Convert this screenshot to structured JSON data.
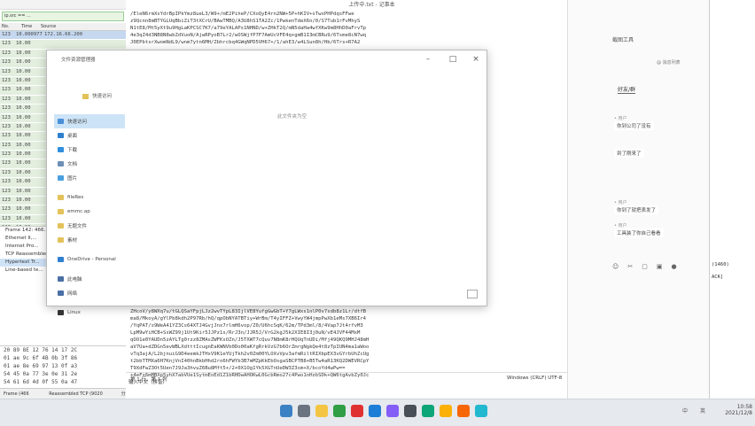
{
  "capture": {
    "filter": "ip.src == ...",
    "headers": [
      "No.",
      "Time",
      "Source"
    ],
    "rows": [
      {
        "no": "123",
        "time": "10.000977",
        "src": "172.16.66.200",
        "sel": true
      },
      {
        "no": "123",
        "time": "10.00",
        "src": "",
        "sel": false
      },
      {
        "no": "123",
        "time": "10.00",
        "src": "",
        "sel": false
      },
      {
        "no": "123",
        "time": "10.00",
        "src": "",
        "sel": false
      },
      {
        "no": "123",
        "time": "10.00",
        "src": "",
        "sel": false
      },
      {
        "no": "123",
        "time": "10.00",
        "src": "",
        "sel": false
      },
      {
        "no": "123",
        "time": "10.00",
        "src": "",
        "sel": false
      },
      {
        "no": "123",
        "time": "10.00",
        "src": "",
        "sel": false
      },
      {
        "no": "123",
        "time": "10.00",
        "src": "",
        "sel": false
      },
      {
        "no": "123",
        "time": "10.00",
        "src": "",
        "sel": false
      },
      {
        "no": "123",
        "time": "10.00",
        "src": "",
        "sel": false
      },
      {
        "no": "123",
        "time": "10.00",
        "src": "",
        "sel": false
      },
      {
        "no": "123",
        "time": "10.00",
        "src": "",
        "sel": false
      },
      {
        "no": "123",
        "time": "10.00",
        "src": "",
        "sel": false
      },
      {
        "no": "123",
        "time": "10.00",
        "src": "",
        "sel": false
      },
      {
        "no": "123",
        "time": "10.00",
        "src": "",
        "sel": false
      },
      {
        "no": "123",
        "time": "10.00",
        "src": "",
        "sel": false
      },
      {
        "no": "123",
        "time": "10.00",
        "src": "",
        "sel": false
      },
      {
        "no": "123",
        "time": "10.00",
        "src": "",
        "sel": false
      },
      {
        "no": "123",
        "time": "10.00",
        "src": "",
        "sel": false
      },
      {
        "no": "123",
        "time": "10.00",
        "src": "",
        "sel": false
      },
      {
        "no": "123",
        "time": "10.00",
        "src": "",
        "sel": false
      }
    ],
    "details": [
      "Frame 142: 466...",
      "Ethernet II,...",
      "Internet Pro...",
      "TCP Reassembled...",
      "Hypertext Tr...",
      "Line-based te..."
    ],
    "hex": [
      {
        "offset": "",
        "bytes": "20 89 8E 12 76 14 17 2C"
      },
      {
        "offset": "",
        "bytes": "01 ae 9c 6f 4B 0b 3f 86"
      },
      {
        "offset": "",
        "bytes": "01 ae 8e 69 97 13 0f a3"
      },
      {
        "offset": "",
        "bytes": "54 45 0a 77 3e 0e 31 2e"
      },
      {
        "offset": "",
        "bytes": "54 61 6d 4d 0f 55 0a 47"
      }
    ],
    "status": [
      "Frame (466 bytes)",
      "Reassembled TCP (9020 bytes)"
    ],
    "status_right": "分组"
  },
  "text_window": {
    "title": "上传中.txt - 记事本",
    "lines_top": [
      "/EleN6rmXsYdrBpIPkYmz8ueL3/W9+/mE2PiheP/CXoQyE4rn2NW+5P+hKIV+sTwxPHPdqsFFwe",
      "z9Qcnn8mBTYGLUqBbiZiT3tXCrU/BAwTMBQ/A3U8hS1TA2Zc/1PwkenTdeX6n/0/S7Tub1rFvMhyS",
      "N1tE8/Mt5yXt9u9HgLaKPCSC7K7/a79eYALAPs1NHND/w+ZHkT2Q/mN5daHa4wfXKw9m8HhD0aFrvTp",
      "4e3qZ4d3NB8N8wbZdVuoN/AjwRPyoB7Lr2/wOSWjfP7F7AmUcVFE4q+gmB1I3mCBRu9/6Tsme8cN7wq",
      "J0EPbtsrXwomNdL9/wnm7ytn6MH/Zbhrcbq4GWqNPD5VH67+/1/ahE3/w4LSun8h/Hb/6Trs+R7A2"
    ],
    "lines_bottom": [
      "Ydd7WQrk+AbAHGhLB0wmTfNEMKfMVT0fbMgZu2Sg0bBDbtWFh0X6HkdnhoV4+4+GgBt9h3XbX5FUmkk",
      "ZHcoV/y8WXq7u/tGLQSaYFpjLJz2wvTYpL83IjlVE8YufgGwGbT+Y7gLWxs1nlP0v7sdb8z1Lr/dtfB",
      "ma8/MkoyA/gYlPb8kdh2P97Rb/hQ/qpObNYATBTiy+WrBm/T4yIFFZ+VwyYW4jmpPwXb1eMs7XB6Ir4",
      "/YqPAT/s9WeA41YZ3Cs64XTJ4GvjJnx7rlmH6vop/Z0/U6hcSqK/62m/TPd3ml/8/4Vap7Jt4rfvM3",
      "LpM9wYiHCB+SsWZ99j1Ut9Kir5JJPz1s/RrJ3n/JJR5J/VrG2kgJ5k2XIE8I3j0uN/vE4JVF44MxM",
      "qOO1e0YAUDn5zAYLTg0rzz8ZMAsZWFKsOZn/J5TXWT7cQuv7N8mK8rHQUqTnUDi/Mfj49QKQ9MHJ48mH",
      "aV7Ua+dZDGn5evWBLXdtttIcugnEaKWNVb0Do00aKfgRrkVzG7b6OrZmrgNgkQe4t8zTpIUN4ma1aWoo",
      "vTq3ajA/L2bjnuiG9D4eemkJTHsV9K1eYUjTkh2v0Zm00YLOXvVpv3afmRiltRIXbpEX3vGYrbUhZcUg",
      "t2bbTTMXa6H7KnjVnI40hnBkbHhd2ro6hFWYb3B7mMZpKkEbOsgaSBCPTB8+B5Tw4aR13KQ2DWEVRCpY",
      "T9XdFwZ3Ot5Uen7J9Ja3hvuZ6Bu8Mft5+/2+0X1Og1Yk5XGTnUeDW3Z3sm+X/bcoYd4wPw==",
      "+4eFx6mMBXp5yhX7abVUe1SytmEoEd1Z1bRHDwAHOKwL0GcbRmo27c4Pwo1nHzbSDk+QW6tgAvbZy0Jc"
    ],
    "status_pos": "第 1 行，第 1 列",
    "status_enc": "Windows (CRLF)   UTF-8"
  },
  "dialog": {
    "title": "文件资源管理器",
    "address": "快速访问",
    "empty_text": "此文件夹为空",
    "sidebar": [
      {
        "label": "快速访问",
        "color": "#4a90d9",
        "icon": "star-icon",
        "sel": true
      },
      {
        "label": "桌面",
        "color": "#2f7fd0",
        "icon": "desktop-icon",
        "sel": false
      },
      {
        "label": "下载",
        "color": "#2f8fdd",
        "icon": "download-icon",
        "sel": false
      },
      {
        "label": "文档",
        "color": "#6d8fb5",
        "icon": "document-icon",
        "sel": false
      },
      {
        "label": "图片",
        "color": "#4aa0e0",
        "icon": "picture-icon",
        "sel": false
      },
      {
        "label": "fileRes",
        "color": "#e3c25a",
        "icon": "folder-icon",
        "sel": false
      },
      {
        "label": "emmc.ap",
        "color": "#e3c25a",
        "icon": "folder-icon",
        "sel": false
      },
      {
        "label": "无题文件",
        "color": "#e3c25a",
        "icon": "folder-icon",
        "sel": false
      },
      {
        "label": "素材",
        "color": "#e3c25a",
        "icon": "folder-icon",
        "sel": false
      },
      {
        "label": "OneDrive - Personal",
        "color": "#2f7fd0",
        "icon": "cloud-icon",
        "sel": false
      },
      {
        "label": "此电脑",
        "color": "#4a6fa5",
        "icon": "computer-icon",
        "sel": false
      },
      {
        "label": "网络",
        "color": "#4a6fa5",
        "icon": "network-icon",
        "sel": false
      },
      {
        "label": "Linux",
        "color": "#333333",
        "icon": "penguin-icon",
        "sel": false
      }
    ]
  },
  "chat": {
    "header": "截图工具",
    "tab": "好友/群",
    "subtitle": "@ 消息列表",
    "messages": [
      {
        "name": "• 用户",
        "text": "你到公司了没有"
      },
      {
        "name": "",
        "text": "到了刚来了"
      },
      {
        "name": "• 用户",
        "text": "你到了就把表发了"
      },
      {
        "name": "• 用户",
        "text": "工具装了你自己看看"
      }
    ],
    "icons": [
      "emoji-icon",
      "scissors-icon",
      "file-icon",
      "image-icon",
      "mic-icon"
    ]
  },
  "right_panel": {
    "lines": [
      "(1460)",
      "ACK]"
    ]
  },
  "ime_hint": "输入中文（拼音）",
  "taskbar": {
    "items": [
      "截图工具",
      "记事本",
      "文件资源管理器",
      "Wireshark"
    ],
    "tray": [
      "中",
      "英",
      "拼"
    ],
    "time": "10:58",
    "date": "2021/12/8"
  }
}
